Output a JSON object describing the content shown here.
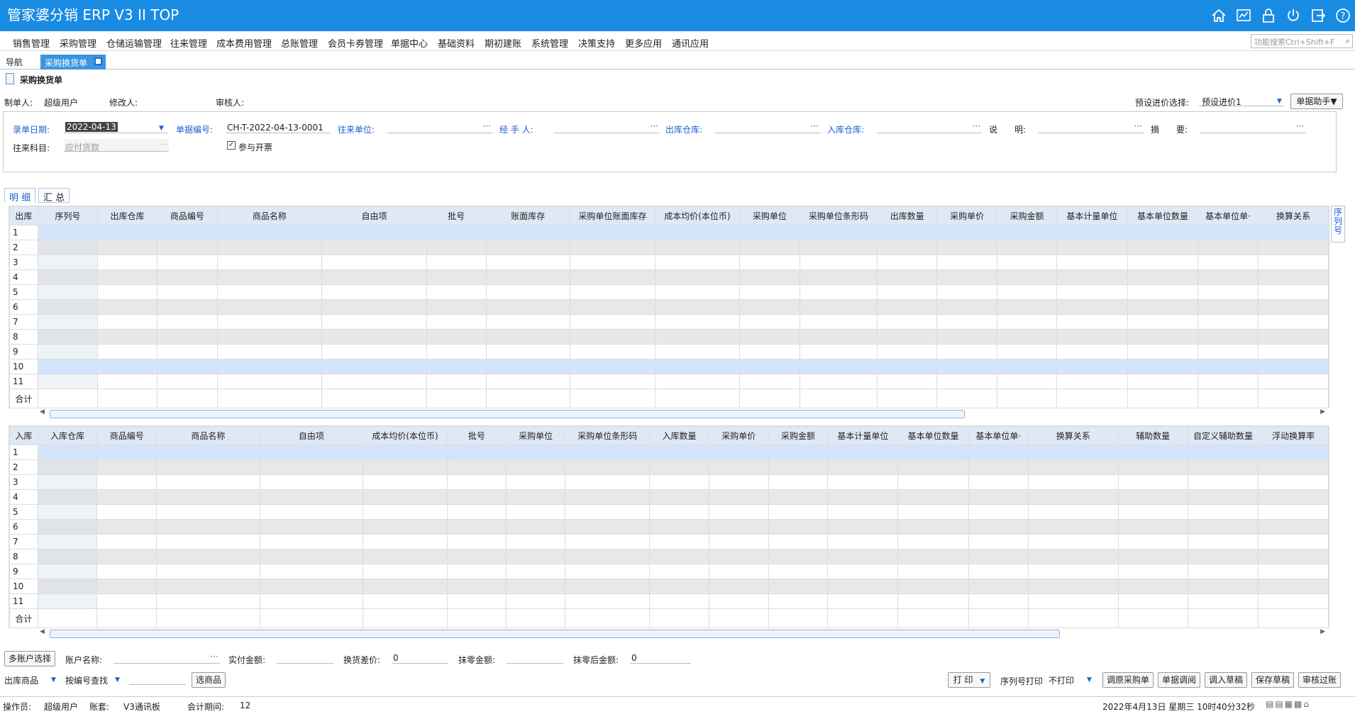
{
  "app": {
    "title": "管家婆分销 ERP V3 II TOP"
  },
  "title_icons": [
    "home-icon",
    "chart-icon",
    "lock-icon",
    "power-icon",
    "exit-icon",
    "help-icon"
  ],
  "menu": [
    "销售管理",
    "采购管理",
    "仓储运输管理",
    "往来管理",
    "成本费用管理",
    "总账管理",
    "会员卡券管理",
    "单据中心",
    "基础资料",
    "期初建账",
    "系统管理",
    "决策支持",
    "更多应用",
    "通讯应用"
  ],
  "search": {
    "placeholder": "功能搜索Ctrl+Shift+F"
  },
  "tabs": {
    "nav": "导航",
    "doc": "采购换货单"
  },
  "doc": {
    "title": "采购换货单"
  },
  "meta": {
    "maker_label": "制单人:",
    "maker_value": "超级用户",
    "modifier_label": "修改人:",
    "reviewer_label": "审核人:",
    "preset_label": "预设进价选择:",
    "preset_value": "预设进价1",
    "helper_btn": "单据助手▼"
  },
  "form": {
    "date_label": "录单日期:",
    "date_value": "2022-04-13",
    "number_label": "单据编号:",
    "number_value": "CH-T-2022-04-13-0001",
    "partner_label": "往来单位:",
    "handler_label": "经 手 人:",
    "out_wh_label": "出库仓库:",
    "in_wh_label": "入库仓库:",
    "note_label": "说　　明:",
    "summary_label": "摘　　要:",
    "subject_label": "往来科目:",
    "subject_value": "应付货款",
    "invoice_label": "参与开票"
  },
  "subtabs": {
    "detail": "明 细",
    "summary": "汇 总"
  },
  "side_tab": "序列号",
  "out_grid": {
    "corner": "出库",
    "columns": [
      "序列号",
      "出库仓库",
      "商品编号",
      "商品名称",
      "自由项",
      "批号",
      "账面库存",
      "采购单位账面库存",
      "成本均价(本位币)",
      "采购单位",
      "采购单位条形码",
      "出库数量",
      "采购单价",
      "采购金额",
      "基本计量单位",
      "基本单位数量",
      "基本单位单·",
      "换算关系"
    ],
    "rows": [
      "1",
      "2",
      "3",
      "4",
      "5",
      "6",
      "7",
      "8",
      "9",
      "10",
      "11"
    ],
    "total": "合计"
  },
  "in_grid": {
    "corner": "入库",
    "columns": [
      "入库仓库",
      "商品编号",
      "商品名称",
      "自由项",
      "成本均价(本位币)",
      "批号",
      "采购单位",
      "采购单位条形码",
      "入库数量",
      "采购单价",
      "采购金额",
      "基本计量单位",
      "基本单位数量",
      "基本单位单·",
      "换算关系",
      "辅助数量",
      "自定义辅助数量",
      "浮动换算率"
    ],
    "rows": [
      "1",
      "2",
      "3",
      "4",
      "5",
      "6",
      "7",
      "8",
      "9",
      "10",
      "11"
    ],
    "total": "合计"
  },
  "bottom": {
    "multi_account_btn": "多账户选择",
    "account_label": "账户名称:",
    "paid_label": "实付金额:",
    "diff_label": "换货差价:",
    "diff_value": "0",
    "writeoff_label": "抹零金额:",
    "after_label": "抹零后金额:",
    "after_value": "0",
    "out_goods": "出库商品",
    "find_by": "按编号查找",
    "select_goods_btn": "选商品",
    "print_btn": "打 印",
    "serial_print_label": "序列号打印",
    "serial_print_value": "不打印",
    "actions": [
      "调原采购单",
      "单据调阅",
      "调入草稿",
      "保存草稿",
      "审核过账"
    ]
  },
  "status": {
    "operator_label": "操作员:",
    "operator_value": "超级用户",
    "book_label": "账套:",
    "book_value": "V3通讯板",
    "period_label": "会计期间:",
    "period_value": "12",
    "datetime": "2022年4月13日 星期三 10时40分32秒"
  }
}
